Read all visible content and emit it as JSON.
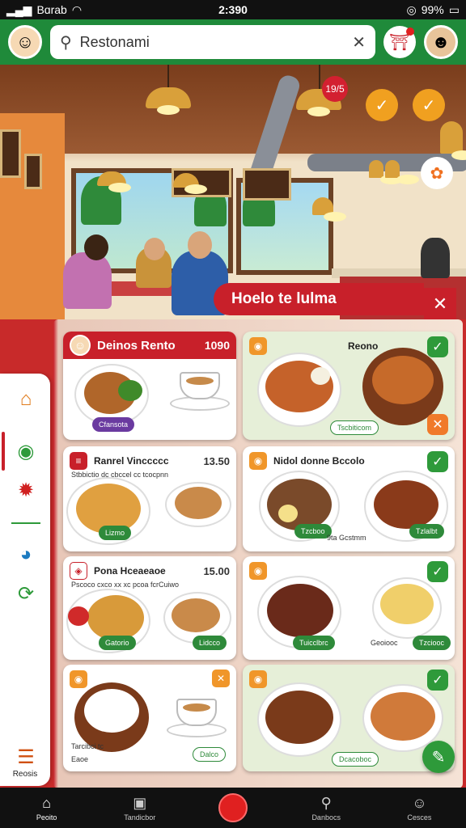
{
  "status_bar": {
    "carrier": "Bɑrab",
    "time": "2:390",
    "battery": "99%"
  },
  "header": {
    "search_value": "Restonami"
  },
  "hero": {
    "banner_text": "Hoelo te lulma",
    "badge": "19/5"
  },
  "cards": [
    {
      "title": "Deinos Rento",
      "price": "1090",
      "chip": "Cfansota"
    },
    {
      "title": "Reono",
      "chip": "Tscbiticom"
    },
    {
      "title": "Ranrel Vinccccc",
      "subtitle": "Stbbictio dc cbccel cc tcocpnn",
      "price": "13.50",
      "chip_left": "Lizmo",
      "chip_right": ""
    },
    {
      "title": "Nidol donne Bccolo",
      "chip_left": "Tzcboo",
      "chip_right": "Tzlalbt",
      "label": "9ta Gcstmm"
    },
    {
      "title": "Pona Hceaeaoe",
      "subtitle": "Pscoco cxco xx xc pcoa fcrCuiwo",
      "price": "15.00",
      "chip_left": "Gatorio",
      "chip_right": "Lidcco"
    },
    {
      "title": "",
      "chip_left": "Tuicclbrc",
      "label": "Geoiooc",
      "chip_right": "Tzciooc"
    },
    {
      "title": "",
      "label_top": "Tarcibci tc",
      "label_bottom": "Eaoe",
      "chip": "Dalco"
    },
    {
      "title": "",
      "chip": "Dcacoboc"
    }
  ],
  "rail": {
    "bottom_label": "Reosis"
  },
  "bottom_nav": [
    {
      "label": "Peoito",
      "icon": "home-icon"
    },
    {
      "label": "Tandicbor",
      "icon": "tray-icon"
    },
    {
      "label": "",
      "icon": "record-icon"
    },
    {
      "label": "Danbocs",
      "icon": "search-icon"
    },
    {
      "label": "Cesces",
      "icon": "profile-icon"
    }
  ]
}
